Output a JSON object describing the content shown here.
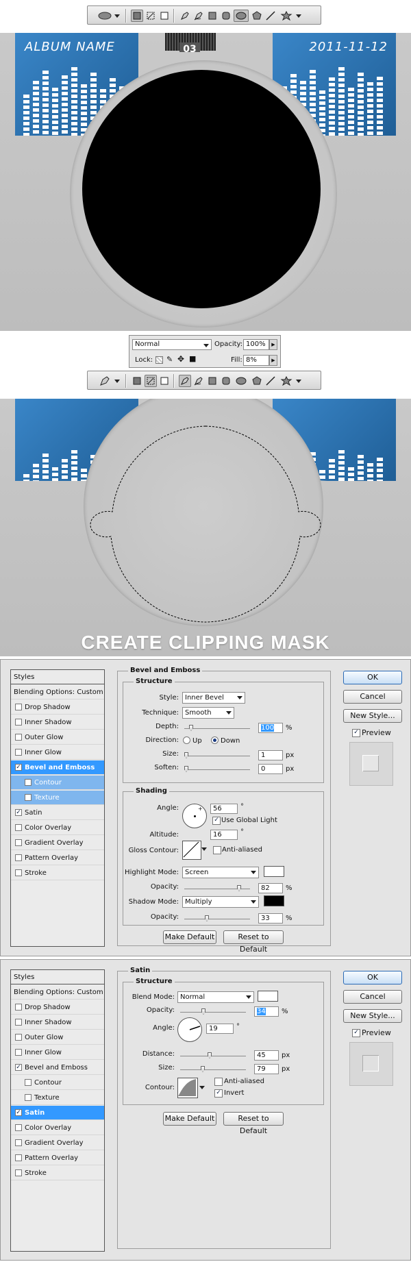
{
  "toolbar_top": {
    "icons": [
      "ellipse-tool-icon",
      "dropdown-arrow-icon",
      "shape-layers-icon",
      "paths-icon",
      "fill-pixels-icon",
      "pen-icon",
      "freeform-pen-icon",
      "rectangle-icon",
      "rounded-rectangle-icon",
      "ellipse-icon",
      "polygon-icon",
      "line-icon",
      "custom-shape-icon",
      "dropdown-arrow-icon"
    ]
  },
  "canvas_top": {
    "album_name": "ALBUM NAME",
    "date": "2011-11-12",
    "track_number": "03"
  },
  "layers_panel": {
    "blend_mode": "Normal",
    "opacity_label": "Opacity:",
    "opacity_value": "100%",
    "lock_label": "Lock:",
    "fill_label": "Fill:",
    "fill_value": "8%"
  },
  "toolbar_middle": {
    "icons": [
      "pen-tool-icon",
      "dropdown-arrow-icon",
      "shape-layers-icon",
      "paths-icon",
      "fill-pixels-icon",
      "pen-icon",
      "freeform-pen-icon",
      "rectangle-icon",
      "rounded-rectangle-icon",
      "ellipse-icon",
      "polygon-icon",
      "line-icon",
      "custom-shape-icon",
      "dropdown-arrow-icon"
    ]
  },
  "canvas_middle": {
    "caption": "CREATE CLIPPING MASK"
  },
  "dialog1": {
    "styles_header": "Styles",
    "blending_options": "Blending Options: Custom",
    "items": [
      {
        "label": "Drop Shadow",
        "checked": false
      },
      {
        "label": "Inner Shadow",
        "checked": false
      },
      {
        "label": "Outer Glow",
        "checked": false
      },
      {
        "label": "Inner Glow",
        "checked": false
      },
      {
        "label": "Bevel and Emboss",
        "checked": true
      },
      {
        "label": "Contour",
        "checked": false
      },
      {
        "label": "Texture",
        "checked": false
      },
      {
        "label": "Satin",
        "checked": true
      },
      {
        "label": "Color Overlay",
        "checked": false
      },
      {
        "label": "Gradient Overlay",
        "checked": false
      },
      {
        "label": "Pattern Overlay",
        "checked": false
      },
      {
        "label": "Stroke",
        "checked": false
      }
    ],
    "section_title": "Bevel and Emboss",
    "structure_title": "Structure",
    "style_label": "Style:",
    "style_value": "Inner Bevel",
    "technique_label": "Technique:",
    "technique_value": "Smooth",
    "depth_label": "Depth:",
    "depth_value": "100",
    "depth_unit": "%",
    "direction_label": "Direction:",
    "up_label": "Up",
    "down_label": "Down",
    "size_label": "Size:",
    "size_value": "1",
    "size_unit": "px",
    "soften_label": "Soften:",
    "soften_value": "0",
    "soften_unit": "px",
    "shading_title": "Shading",
    "angle_label": "Angle:",
    "angle_value": "56",
    "angle_unit": "°",
    "global_light_label": "Use Global Light",
    "altitude_label": "Altitude:",
    "altitude_value": "16",
    "altitude_unit": "°",
    "gloss_label": "Gloss Contour:",
    "anti_aliased_label": "Anti-aliased",
    "highlight_label": "Highlight Mode:",
    "highlight_value": "Screen",
    "highlight_opacity_label": "Opacity:",
    "highlight_opacity_value": "82",
    "highlight_opacity_unit": "%",
    "shadow_label": "Shadow Mode:",
    "shadow_value": "Multiply",
    "shadow_opacity_label": "Opacity:",
    "shadow_opacity_value": "33",
    "shadow_opacity_unit": "%",
    "make_default": "Make Default",
    "reset_default": "Reset to Default",
    "ok": "OK",
    "cancel": "Cancel",
    "new_style": "New Style...",
    "preview": "Preview",
    "highlight_color": "#ffffff",
    "shadow_color": "#000000"
  },
  "dialog2": {
    "styles_header": "Styles",
    "blending_options": "Blending Options: Custom",
    "items": [
      {
        "label": "Drop Shadow",
        "checked": false
      },
      {
        "label": "Inner Shadow",
        "checked": false
      },
      {
        "label": "Outer Glow",
        "checked": false
      },
      {
        "label": "Inner Glow",
        "checked": false
      },
      {
        "label": "Bevel and Emboss",
        "checked": true
      },
      {
        "label": "Contour",
        "checked": false
      },
      {
        "label": "Texture",
        "checked": false
      },
      {
        "label": "Satin",
        "checked": true
      },
      {
        "label": "Color Overlay",
        "checked": false
      },
      {
        "label": "Gradient Overlay",
        "checked": false
      },
      {
        "label": "Pattern Overlay",
        "checked": false
      },
      {
        "label": "Stroke",
        "checked": false
      }
    ],
    "section_title": "Satin",
    "structure_title": "Structure",
    "blend_label": "Blend Mode:",
    "blend_value": "Normal",
    "opacity_label": "Opacity:",
    "opacity_value": "34",
    "opacity_unit": "%",
    "angle_label": "Angle:",
    "angle_value": "19",
    "angle_unit": "°",
    "distance_label": "Distance:",
    "distance_value": "45",
    "distance_unit": "px",
    "size_label": "Size:",
    "size_value": "79",
    "size_unit": "px",
    "contour_label": "Contour:",
    "anti_aliased_label": "Anti-aliased",
    "invert_label": "Invert",
    "make_default": "Make Default",
    "reset_default": "Reset to Default",
    "ok": "OK",
    "cancel": "Cancel",
    "new_style": "New Style...",
    "preview": "Preview",
    "satin_color": "#ffffff"
  }
}
